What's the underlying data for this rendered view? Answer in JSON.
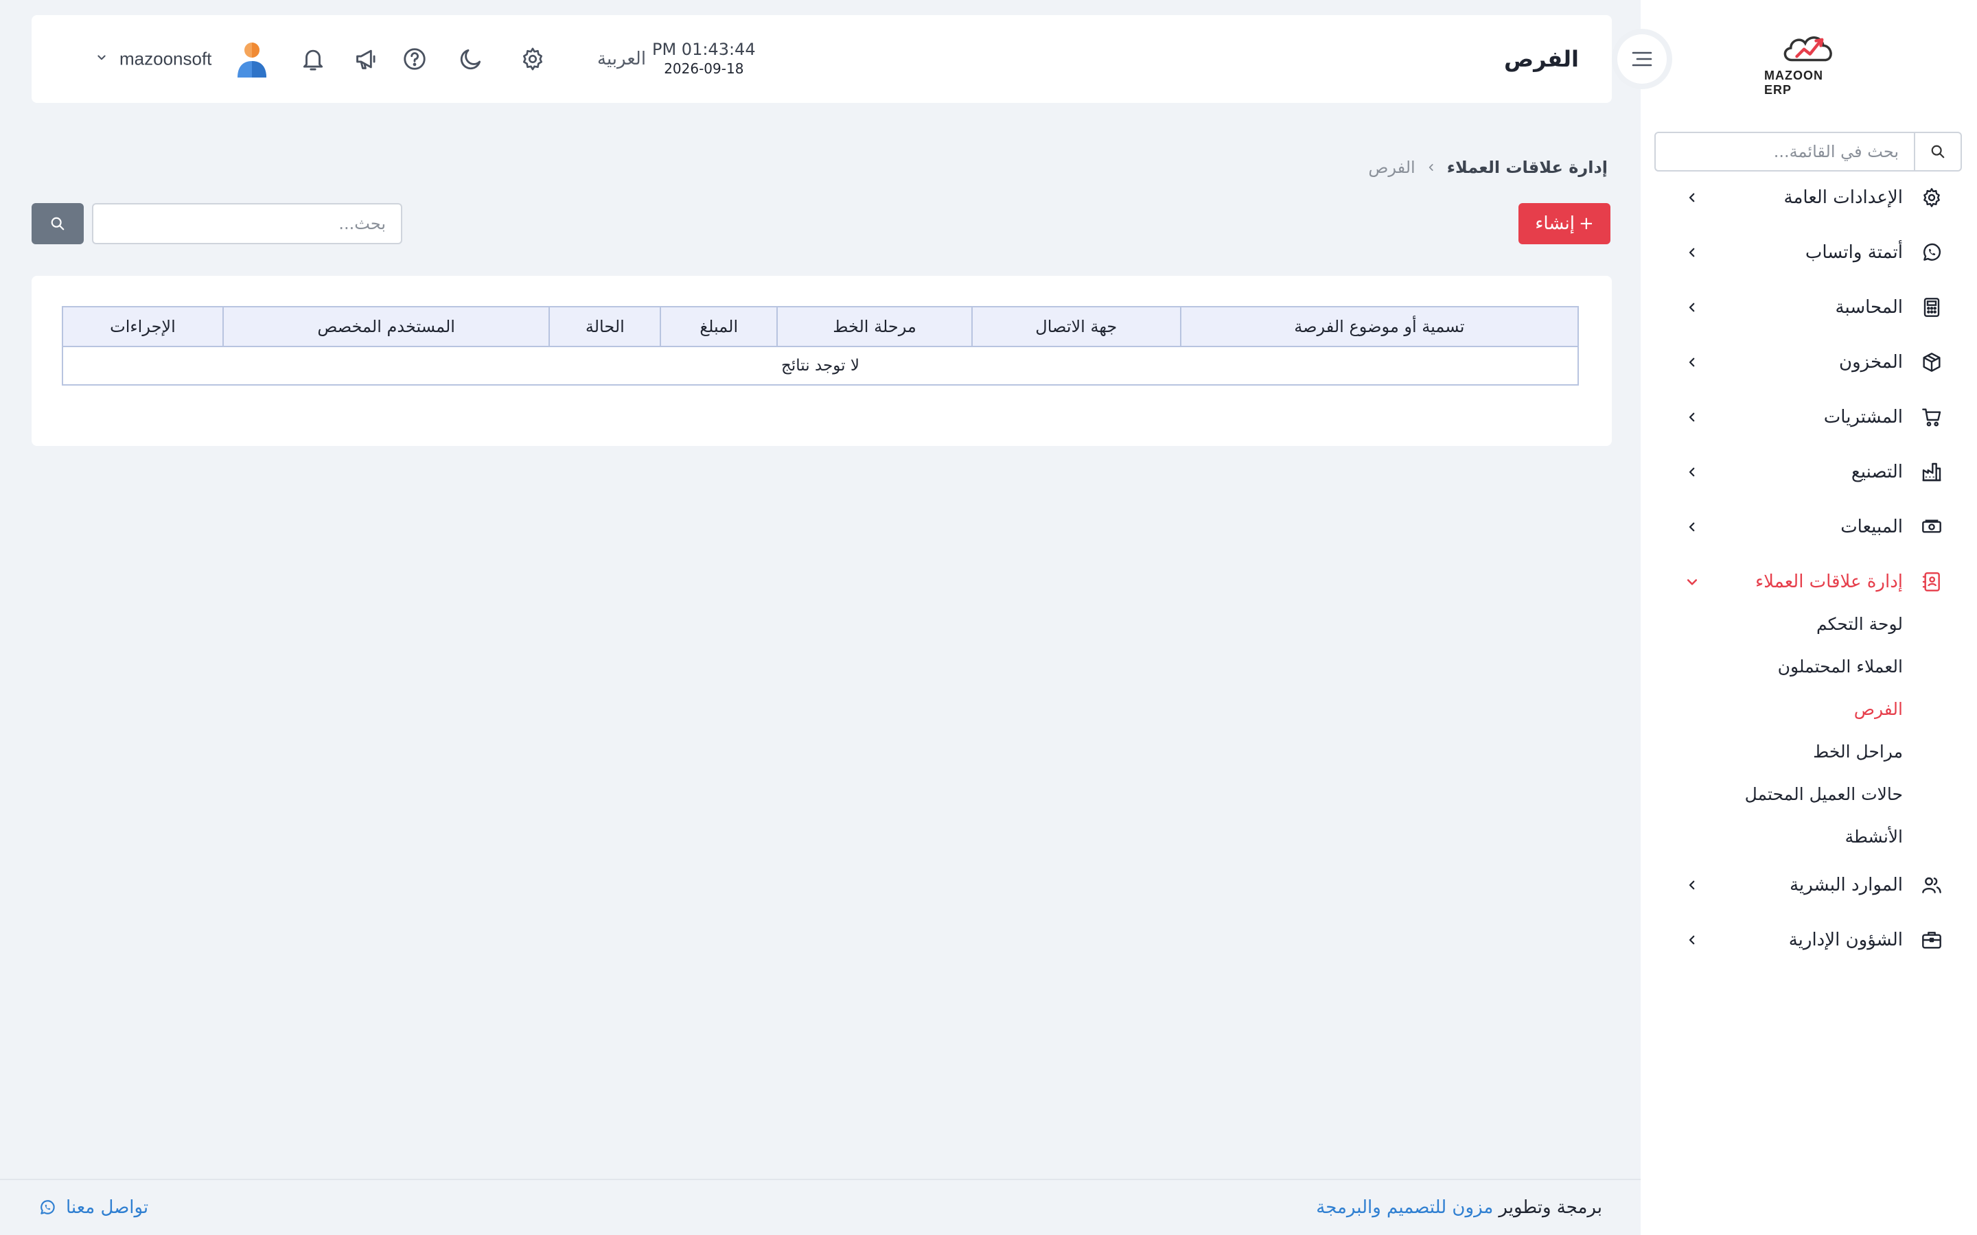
{
  "brand": {
    "logo_text": "MAZOON ERP",
    "accent": "#e63e4b"
  },
  "sidebar": {
    "search_placeholder": "بحث في القائمة...",
    "items": [
      {
        "label": "الإعدادات العامة",
        "icon": "gear-icon"
      },
      {
        "label": "أتمتة واتساب",
        "icon": "whatsapp-icon"
      },
      {
        "label": "المحاسبة",
        "icon": "calculator-icon"
      },
      {
        "label": "المخزون",
        "icon": "box-icon"
      },
      {
        "label": "المشتريات",
        "icon": "cart-icon"
      },
      {
        "label": "التصنيع",
        "icon": "factory-icon"
      },
      {
        "label": "المبيعات",
        "icon": "cash-icon"
      },
      {
        "label": "إدارة علاقات العملاء",
        "icon": "contacts-icon"
      },
      {
        "label": "الموارد البشرية",
        "icon": "users-icon"
      },
      {
        "label": "الشؤون الإدارية",
        "icon": "briefcase-icon"
      }
    ],
    "crm_sub": [
      "لوحة التحكم",
      "العملاء المحتملون",
      "الفرص",
      "مراحل الخط",
      "حالات العميل المحتمل",
      "الأنشطة"
    ]
  },
  "header": {
    "title": "الفرص",
    "time": "PM 01:43:44",
    "date": "2026-09-18",
    "language": "العربية",
    "username": "mazoonsoft"
  },
  "breadcrumb": {
    "parent": "إدارة علاقات العملاء",
    "current": "الفرص"
  },
  "actions": {
    "create_label": "إنشاء",
    "search_placeholder": "بحث..."
  },
  "table": {
    "columns": [
      "تسمية أو موضوع الفرصة",
      "جهة الاتصال",
      "مرحلة الخط",
      "المبلغ",
      "الحالة",
      "المستخدم المخصص",
      "الإجراءات"
    ],
    "empty_text": "لا توجد نتائج"
  },
  "footer": {
    "credit_prefix": "برمجة وتطوير",
    "company": "مزون للتصميم والبرمجة",
    "contact": "تواصل معنا"
  }
}
